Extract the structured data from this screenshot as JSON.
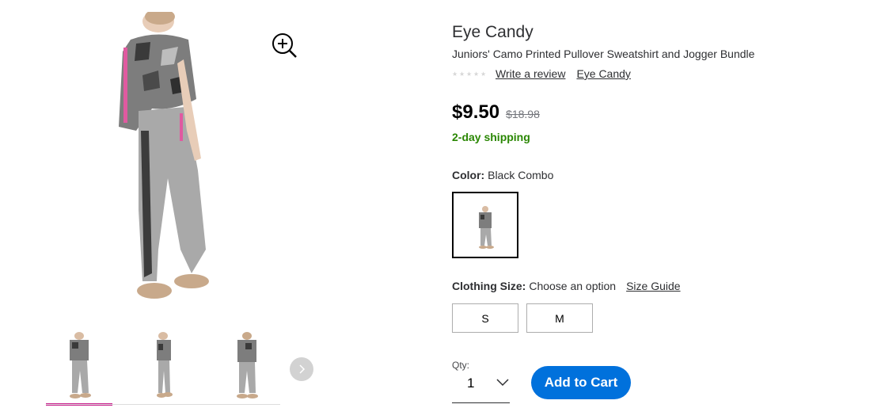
{
  "product": {
    "brand": "Eye Candy",
    "title": "Juniors' Camo Printed Pullover Sweatshirt and Jogger Bundle",
    "rating_stars": 0,
    "write_review": "Write a review",
    "brand_link": "Eye Candy",
    "price": "$9.50",
    "was_price": "$18.98",
    "shipping": "2-day shipping"
  },
  "color": {
    "label": "Color:",
    "value": "Black Combo"
  },
  "size": {
    "label": "Clothing Size:",
    "value": "Choose an option",
    "guide": "Size Guide",
    "options": [
      "S",
      "M"
    ]
  },
  "quantity": {
    "label": "Qty:",
    "value": "1"
  },
  "cart": {
    "button": "Add to Cart"
  },
  "colors": {
    "accent": "#0071dc",
    "shipping_green": "#2a8703",
    "active_thumb": "#c91e8e"
  }
}
